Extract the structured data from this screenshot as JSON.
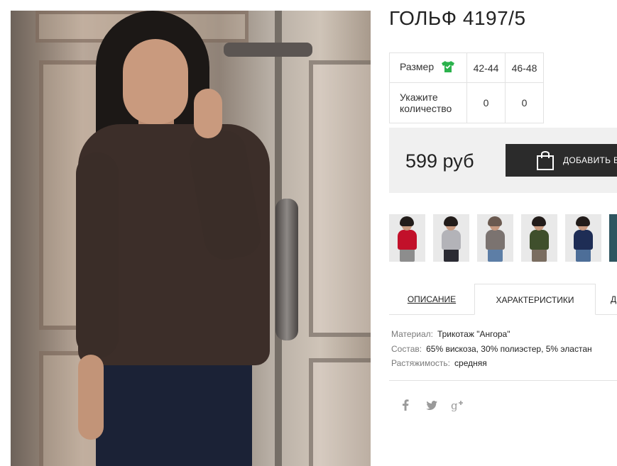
{
  "product": {
    "title": "ГОЛЬФ 4197/5"
  },
  "size_table": {
    "size_label": "Размер",
    "size_icon": "tshirt-icon",
    "size_icon_color": "#2bb24c",
    "quantity_label_line1": "Укажите",
    "quantity_label_line2": "количество",
    "sizes": [
      {
        "size": "42-44",
        "quantity": "0"
      },
      {
        "size": "46-48",
        "quantity": "0"
      }
    ]
  },
  "purchase": {
    "price": "599 руб",
    "add_button_label": "ДОБАВИТЬ В",
    "bag_icon": "shopping-bag-icon"
  },
  "colors": {
    "thumb_variants": [
      "red",
      "grey",
      "grey-brown",
      "olive",
      "navy",
      "teal"
    ]
  },
  "tabs": [
    {
      "label": "ОПИСАНИЕ",
      "active": false
    },
    {
      "label": "ХАРАКТЕРИСТИКИ",
      "active": true
    },
    {
      "label": "Д",
      "active": false
    }
  ],
  "specs": [
    {
      "key": "Материал:",
      "value": "Трикотаж \"Ангора\""
    },
    {
      "key": "Состав:",
      "value": "65% вискоза, 30% полиэстер, 5% эластан"
    },
    {
      "key": "Растяжимость:",
      "value": "средняя"
    }
  ],
  "social": [
    "facebook-icon",
    "twitter-icon",
    "google-plus-icon"
  ]
}
